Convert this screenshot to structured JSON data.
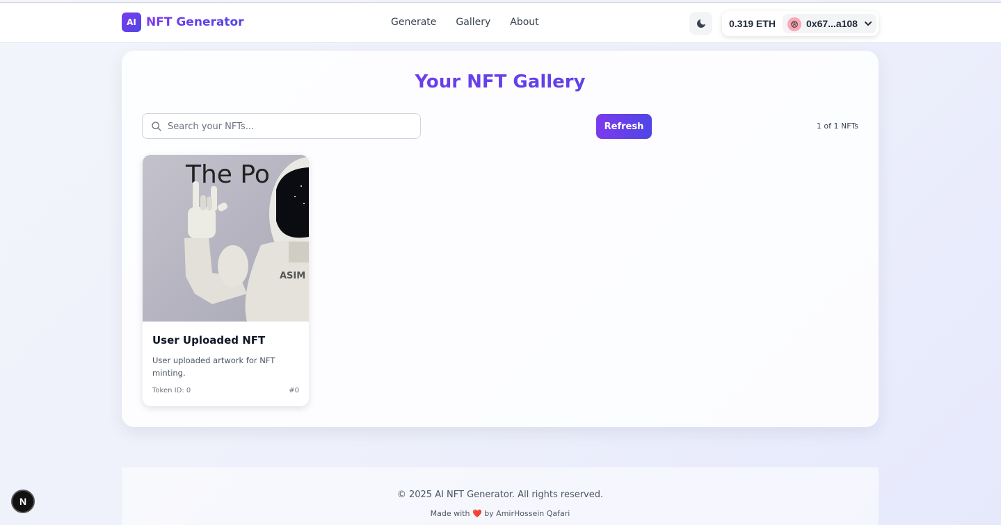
{
  "header": {
    "logo_badge": "AI",
    "logo_text": "NFT Generator",
    "nav": [
      "Generate",
      "Gallery",
      "About"
    ],
    "theme_icon": "moon-icon",
    "balance": "0.319 ETH",
    "address": "0x67...a108",
    "avatar_emoji": "😨"
  },
  "gallery": {
    "title": "Your NFT Gallery",
    "search_placeholder": "Search your NFTs...",
    "refresh_label": "Refresh",
    "count_text": "1 of 1 NFTs",
    "items": [
      {
        "title": "User Uploaded NFT",
        "description": "User uploaded artwork for NFT minting.",
        "token_label": "Token ID: 0",
        "number_label": "#0",
        "image_text": "The Po",
        "robot_text": "ASIM"
      }
    ]
  },
  "footer": {
    "copyright": "© 2025 AI NFT Generator. All rights reserved.",
    "credit_prefix": "Made with",
    "credit_heart": "❤️",
    "credit_suffix": "by AmirHossein Qafari"
  },
  "dev_badge": "N",
  "colors": {
    "accent_start": "#7c3aed",
    "accent_end": "#4f46e5"
  }
}
